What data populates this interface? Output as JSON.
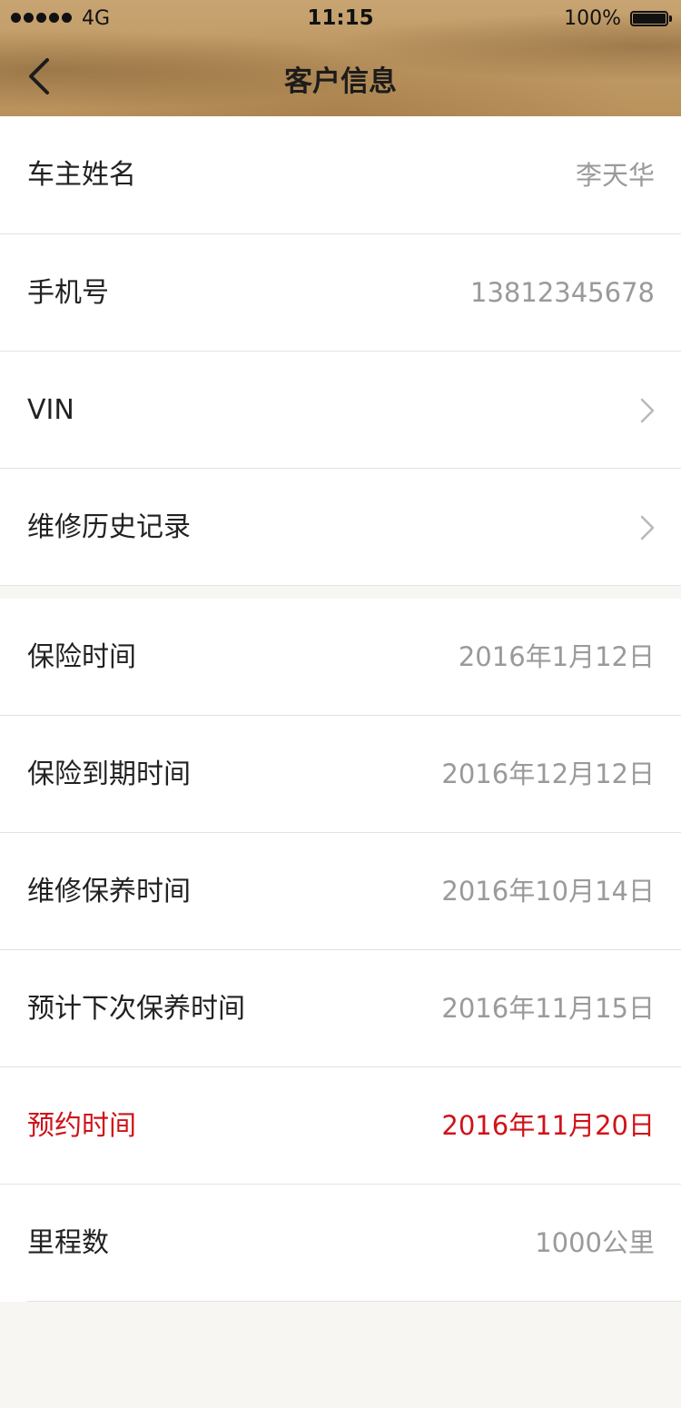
{
  "status_bar": {
    "carrier": "4G",
    "time": "11:15",
    "battery": "100%"
  },
  "nav": {
    "title": "客户信息"
  },
  "rows": [
    {
      "label": "车主姓名",
      "value": "李天华"
    },
    {
      "label": "手机号",
      "value": "13812345678"
    },
    {
      "label": "VIN"
    },
    {
      "label": "维修历史记录"
    },
    {
      "label": "保险时间",
      "value": "2016年1月12日"
    },
    {
      "label": "保险到期时间",
      "value": "2016年12月12日"
    },
    {
      "label": "维修保养时间",
      "value": "2016年10月14日"
    },
    {
      "label": "预计下次保养时间",
      "value": "2016年11月15日"
    },
    {
      "label": "预约时间",
      "value": "2016年11月20日"
    },
    {
      "label": "里程数",
      "value": "1000公里"
    }
  ],
  "colors": {
    "highlight": "#d01218",
    "value": "#9a9a9a",
    "label": "#222222"
  }
}
